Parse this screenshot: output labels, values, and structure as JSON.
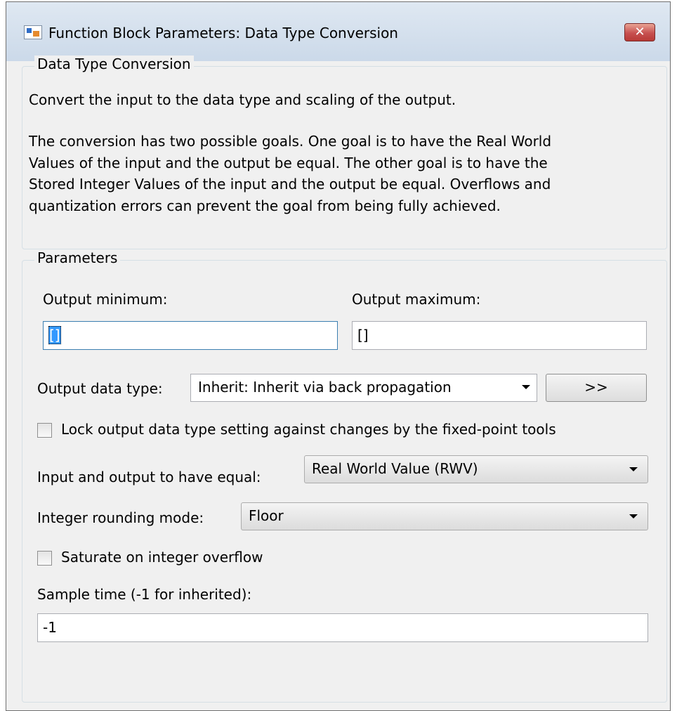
{
  "window": {
    "title": "Function Block Parameters: Data Type Conversion",
    "close_label": "✕"
  },
  "description_group": {
    "legend": "Data Type Conversion",
    "paragraph1": "Convert the input to the data type and scaling of the output.",
    "paragraph2_lines": [
      "The conversion has two possible goals. One goal is to have the Real World",
      "Values of the input and the output be equal.  The other goal is to have the",
      "Stored Integer Values of the input and the output be equal.  Overflows and",
      "quantization errors can prevent the goal from being fully achieved."
    ]
  },
  "parameters": {
    "legend": "Parameters",
    "output_min_label": "Output minimum:",
    "output_min_value": "[]",
    "output_max_label": "Output maximum:",
    "output_max_value": "[]",
    "output_type_label": "Output data type:",
    "output_type_value": "Inherit: Inherit via back propagation",
    "data_type_assistant_label": ">>",
    "lock_label": "Lock output data type setting against changes by the fixed-point tools",
    "lock_checked": false,
    "equal_label": "Input and output to have equal:",
    "equal_value": "Real World Value (RWV)",
    "rounding_label": "Integer rounding mode:",
    "rounding_value": "Floor",
    "saturate_label": "Saturate on integer overflow",
    "saturate_checked": false,
    "sample_time_label": "Sample time (-1 for inherited):",
    "sample_time_value": "-1"
  }
}
